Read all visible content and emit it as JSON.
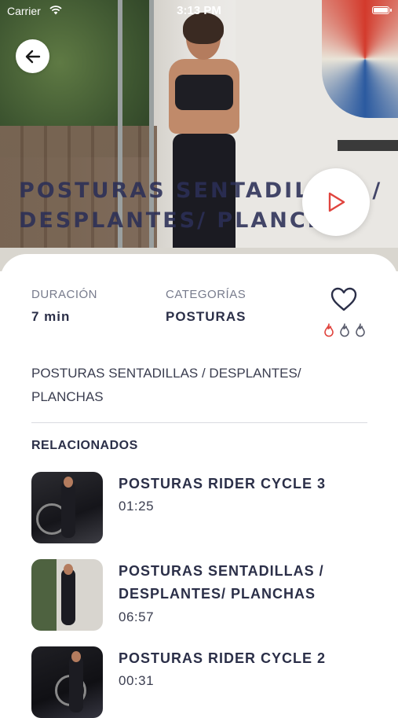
{
  "status_bar": {
    "carrier": "Carrier",
    "time": "3:13 PM"
  },
  "hero": {
    "title_line1": "POSTURAS SENTADILLAS /",
    "title_line2": "DESPLANTES/ PLANCHAS"
  },
  "details": {
    "duration_label": "DURACIÓN",
    "duration_value": "7 min",
    "category_label": "CATEGORÍAS",
    "category_value": "POSTURAS",
    "intensity_level": 1,
    "intensity_max": 3,
    "description": "POSTURAS SENTADILLAS / DESPLANTES/ PLANCHAS"
  },
  "related": {
    "title": "RELACIONADOS",
    "items": [
      {
        "title": "POSTURAS RIDER CYCLE 3",
        "duration": "01:25"
      },
      {
        "title": "POSTURAS SENTADILLAS / DESPLANTES/ PLANCHAS",
        "duration": "06:57"
      },
      {
        "title": "POSTURAS RIDER CYCLE 2",
        "duration": "00:31"
      }
    ]
  },
  "colors": {
    "accent": "#e0443e",
    "text_dark": "#2b2f48",
    "muted": "#777b8c"
  }
}
